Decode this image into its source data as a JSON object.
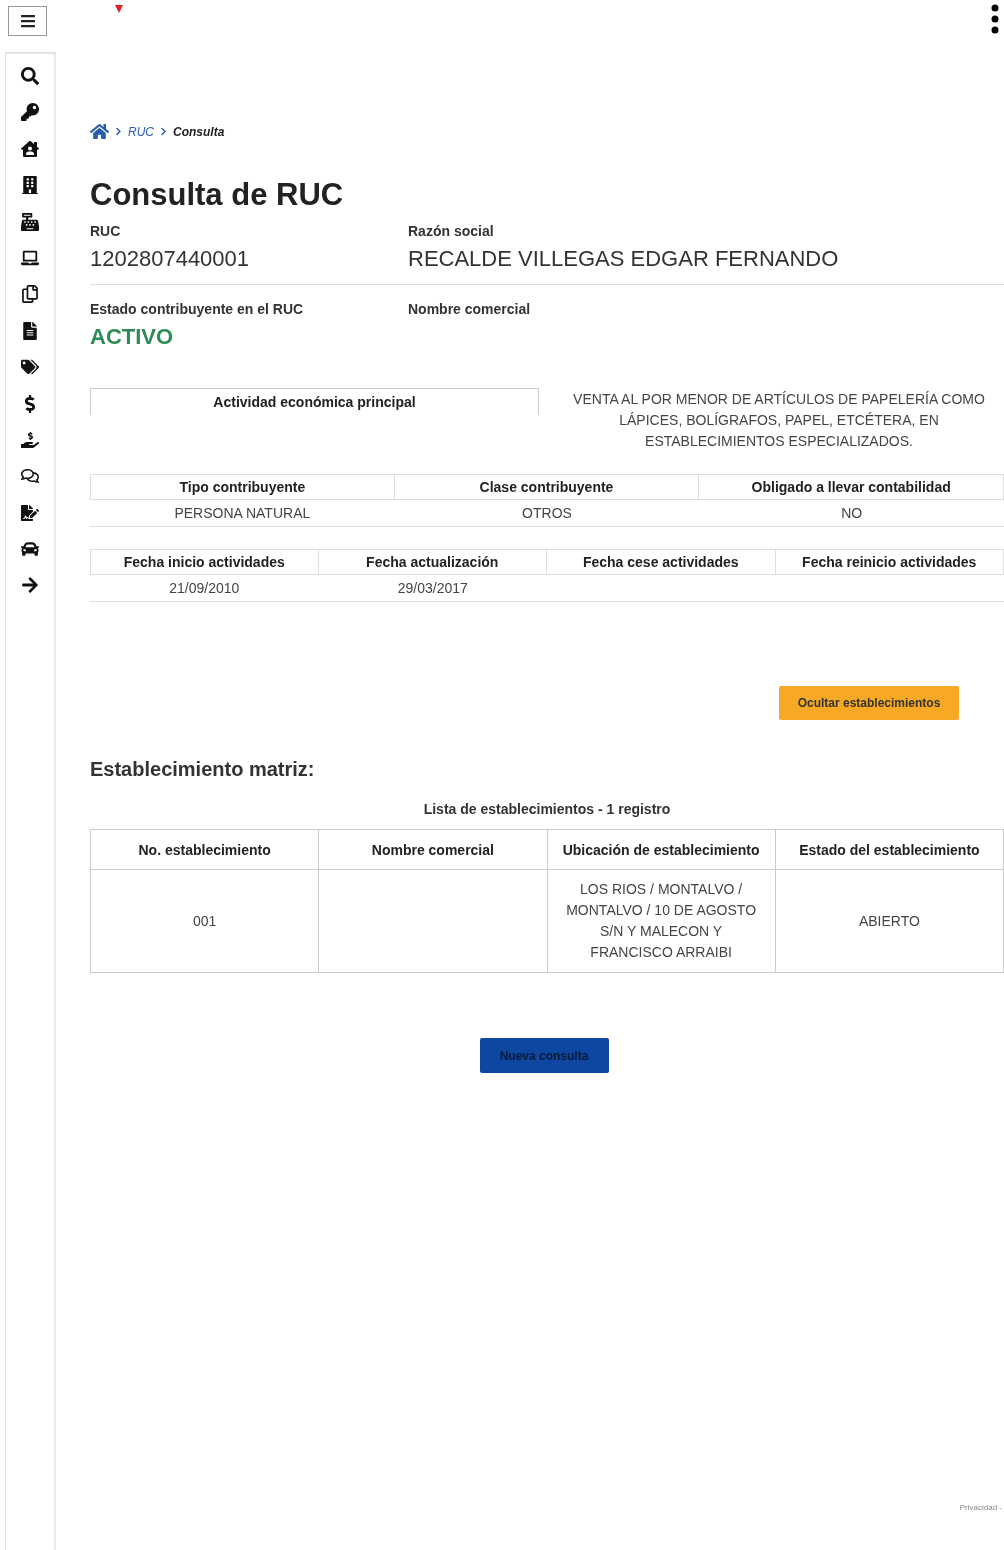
{
  "breadcrumb": {
    "items": [
      {
        "label": "RUC",
        "selected": false
      },
      {
        "label": "Consulta",
        "selected": true
      }
    ]
  },
  "title": "Consulta de RUC",
  "fields": [
    {
      "label": "RUC",
      "value": "1202807440001",
      "kind": "plain"
    },
    {
      "label": "Razón social",
      "value": "RECALDE VILLEGAS EDGAR FERNANDO",
      "kind": "plain"
    },
    {
      "label": "Estado contribuyente en el RUC",
      "value": "ACTIVO",
      "kind": "status"
    },
    {
      "label": "Nombre comercial"
    }
  ],
  "activity": {
    "label": "Actividad económica principal",
    "value": "VENTA AL POR MENOR DE ARTÍCULOS DE PAPELERÍA COMO LÁPICES, BOLÍGRAFOS, PAPEL, ETCÉTERA, EN ESTABLECIMIENTOS ESPECIALIZADOS."
  },
  "info_tables": [
    {
      "columns": [
        "Tipo contribuyente",
        "Clase contribuyente",
        "Obligado a llevar contabilidad"
      ],
      "values": [
        "PERSONA NATURAL",
        "OTROS",
        "NO"
      ]
    },
    {
      "columns": [
        "Fecha inicio actividades",
        "Fecha actualización",
        "Fecha cese actividades",
        "Fecha reinicio actividades"
      ],
      "values": [
        "21/09/2010",
        "29/03/2017"
      ]
    }
  ],
  "toggle_button": "Ocultar establecimientos",
  "establishments": {
    "heading": "Establecimiento matriz:",
    "caption": "Lista de establecimientos - 1 registro",
    "columns": [
      "No. establecimiento",
      "Nombre comercial",
      "Ubicación de establecimiento",
      "Estado del establecimiento"
    ],
    "rows": [
      {
        "number": "001",
        "location": "LOS RIOS / MONTALVO / MONTALVO / 10 DE AGOSTO S/N Y MALECON Y FRANCISCO ARRAIBI",
        "status": "ABIERTO"
      }
    ]
  },
  "new_query_button": "Nueva consulta",
  "footer": {
    "text": "Privacidad -"
  }
}
